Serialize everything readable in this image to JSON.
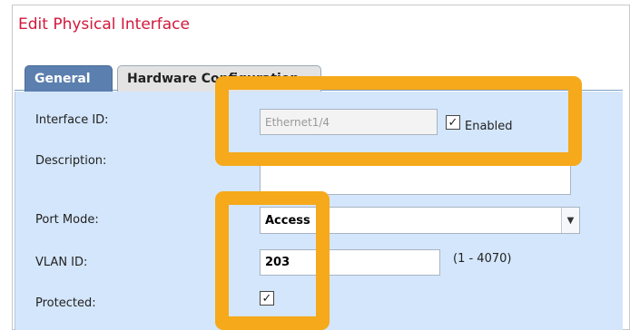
{
  "dialog": {
    "title": "Edit Physical Interface"
  },
  "tabs": [
    {
      "label": "General",
      "active": true
    },
    {
      "label": "Hardware Configuration",
      "active": false
    }
  ],
  "form": {
    "interface_id": {
      "label": "Interface ID:",
      "value": "Ethernet1/4"
    },
    "enabled": {
      "label": "Enabled",
      "checked": true
    },
    "description": {
      "label": "Description:",
      "value": ""
    },
    "port_mode": {
      "label": "Port Mode:",
      "value": "Access"
    },
    "vlan_id": {
      "label": "VLAN ID:",
      "value": "203",
      "range": "(1 - 4070)"
    },
    "protected": {
      "label": "Protected:",
      "checked": true
    }
  },
  "theme": {
    "title_color": "#d2183c",
    "active_tab_color": "#5b7fae",
    "panel_color": "#d4e6fb",
    "highlight_color": "#f6a91a"
  },
  "icons": {
    "select_arrow": "chevron-down-icon",
    "check": "checkmark-icon"
  }
}
